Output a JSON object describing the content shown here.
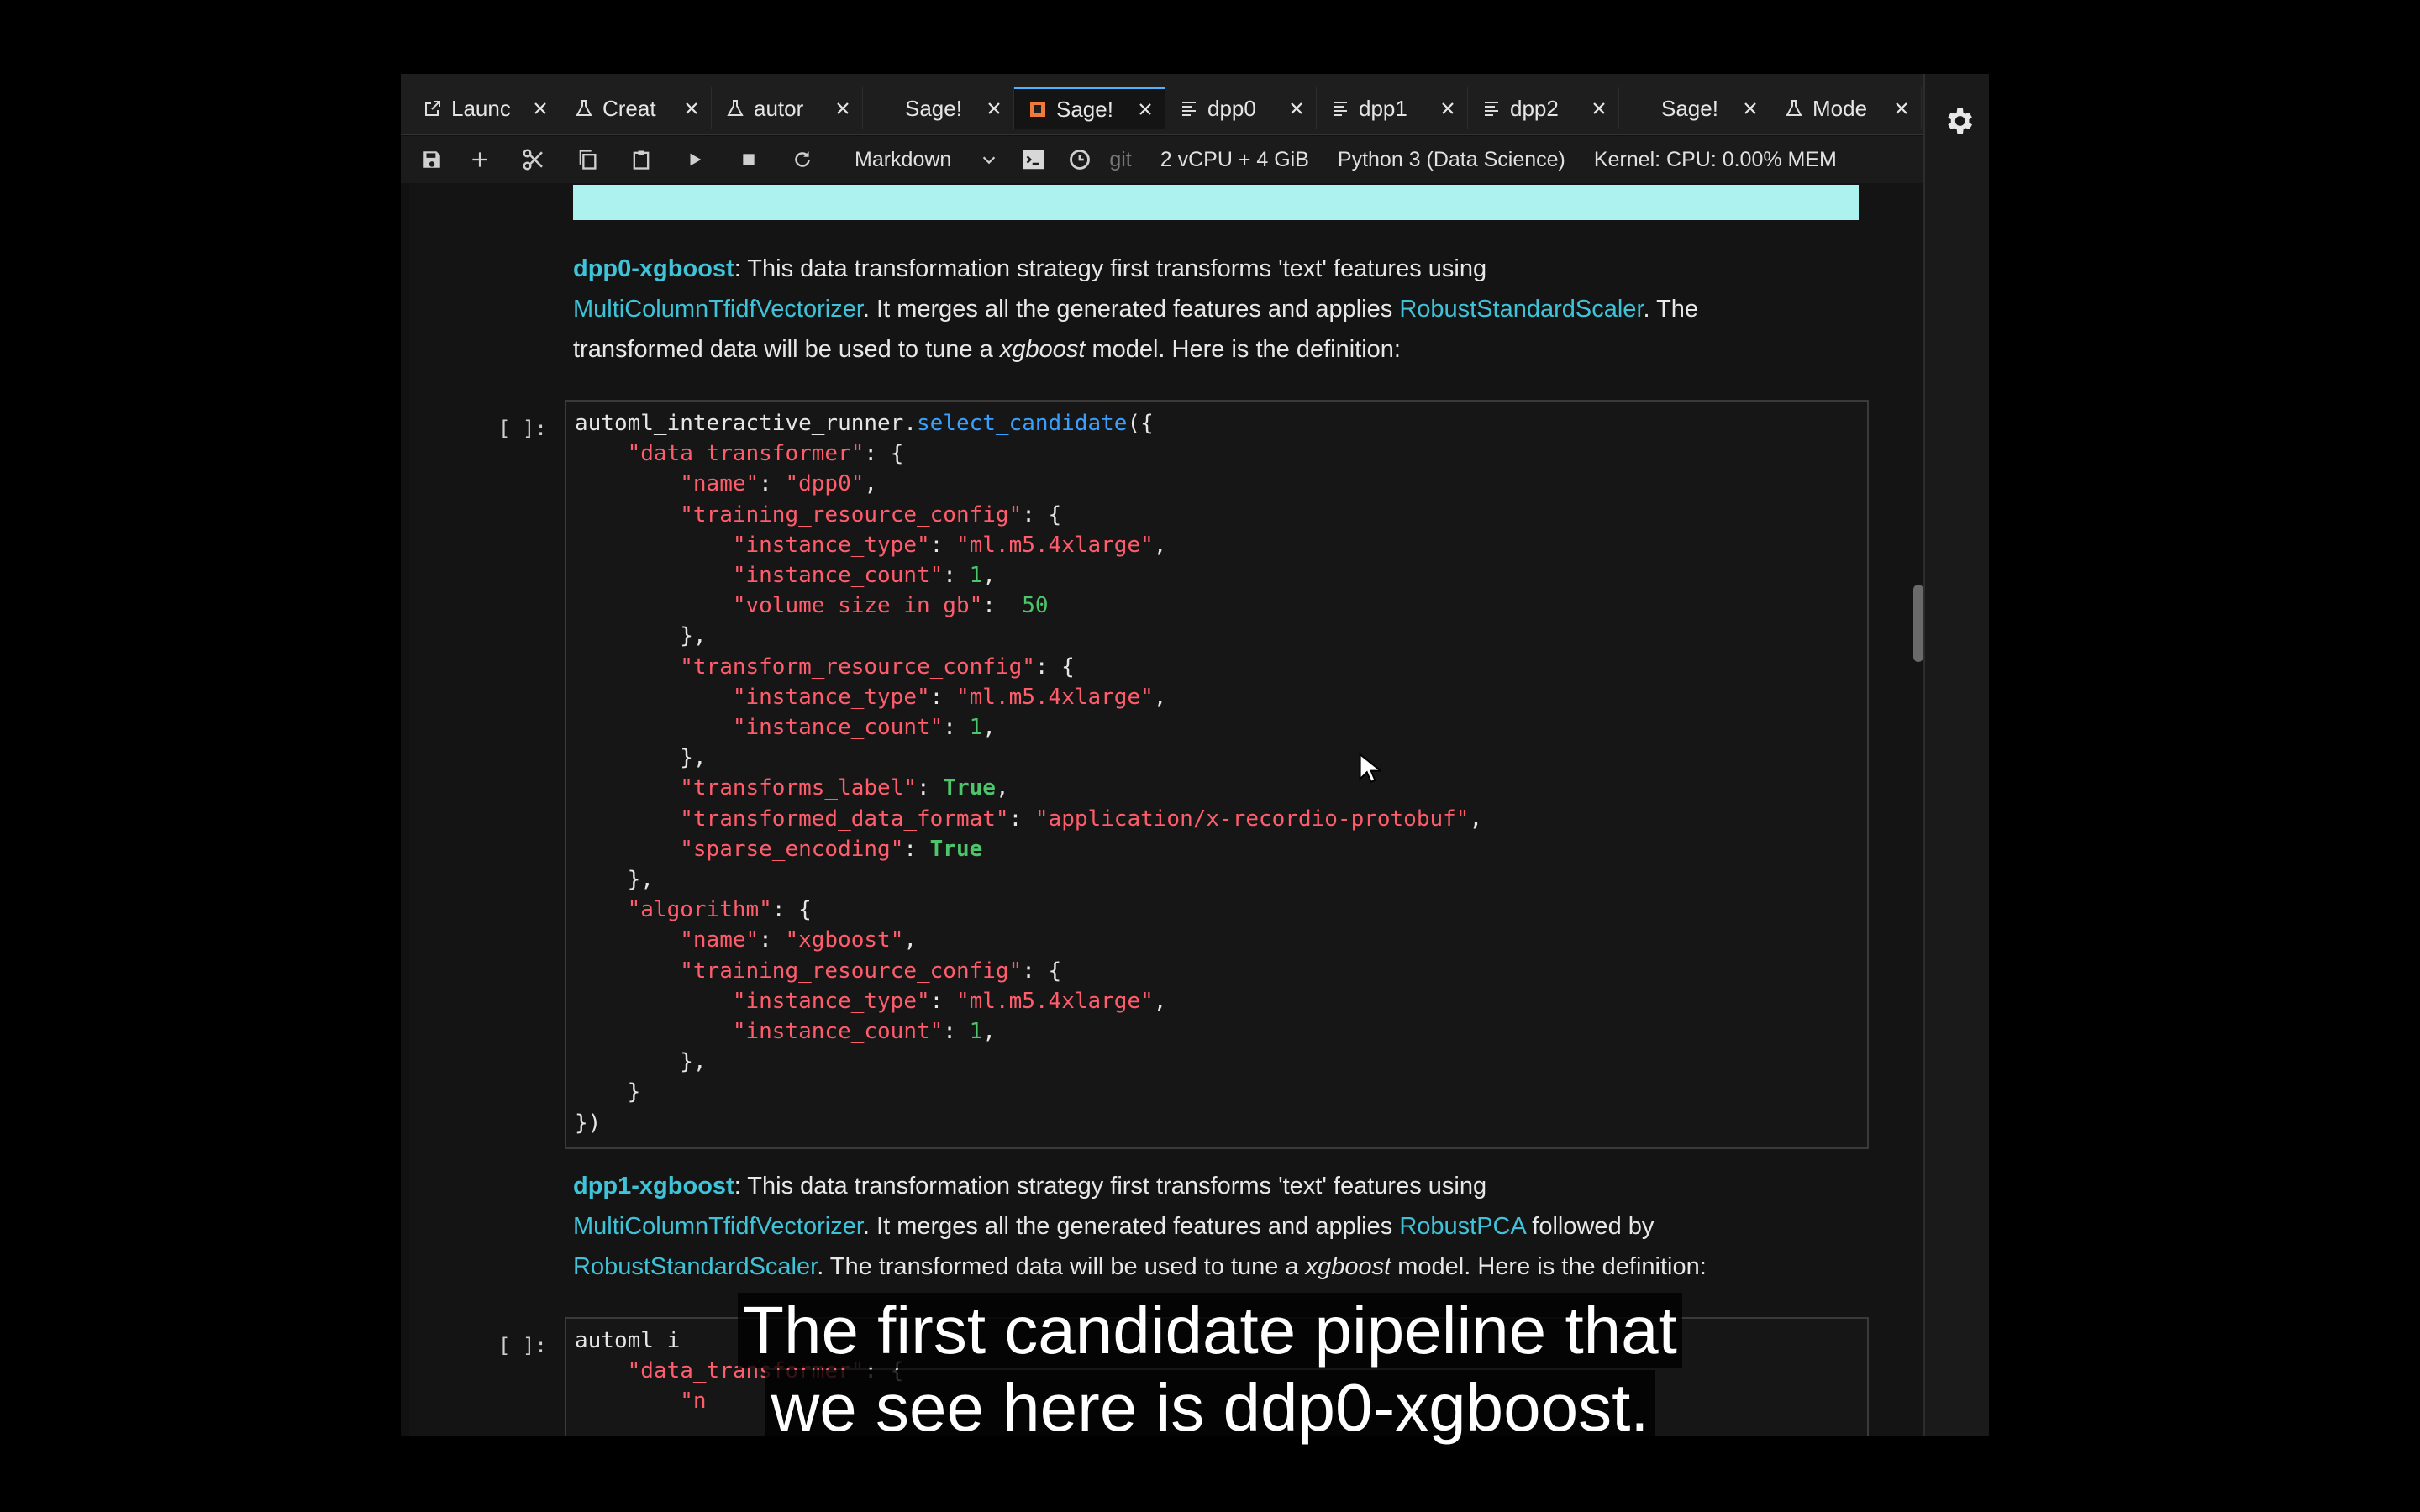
{
  "tabs": [
    {
      "label": "Launc",
      "icon": "external-link-icon"
    },
    {
      "label": "Creat",
      "icon": "flask-icon"
    },
    {
      "label": "autor",
      "icon": "flask-icon"
    },
    {
      "label": "Sage!",
      "icon": "none"
    },
    {
      "label": "Sage!",
      "icon": "notebook-icon",
      "active": true
    },
    {
      "label": "dpp0",
      "icon": "text-file-icon"
    },
    {
      "label": "dpp1",
      "icon": "text-file-icon"
    },
    {
      "label": "dpp2",
      "icon": "text-file-icon"
    },
    {
      "label": "Sage!",
      "icon": "none"
    },
    {
      "label": "Mode",
      "icon": "flask-icon"
    }
  ],
  "toolbar": {
    "cell_type": "Markdown",
    "git": "git",
    "instance": "2 vCPU + 4 GiB",
    "kernel_name": "Python 3 (Data Science)",
    "kernel_status": "Kernel: CPU: 0.00% MEM"
  },
  "md1": {
    "name": "dpp0-xgboost",
    "p1": ": This data transformation strategy first transforms 'text' features using",
    "link1": "MultiColumnTfidfVectorizer",
    "p2": ". It merges all the generated features and applies ",
    "link2": "RobustStandardScaler",
    "p3": ". The",
    "p4": "transformed data will be used to tune a ",
    "model": "xgboost",
    "p5": " model. Here is the definition:"
  },
  "cell1": {
    "prompt": "[ ]:",
    "code": [
      [
        {
          "t": "automl_interactive_runner."
        },
        {
          "t": "select_candidate",
          "c": "fn"
        },
        {
          "t": "({"
        }
      ],
      [
        {
          "t": "    "
        },
        {
          "t": "\"data_transformer\"",
          "c": "s"
        },
        {
          "t": ": {"
        }
      ],
      [
        {
          "t": "        "
        },
        {
          "t": "\"name\"",
          "c": "s"
        },
        {
          "t": ": "
        },
        {
          "t": "\"dpp0\"",
          "c": "s"
        },
        {
          "t": ","
        }
      ],
      [
        {
          "t": "        "
        },
        {
          "t": "\"training_resource_config\"",
          "c": "s"
        },
        {
          "t": ": {"
        }
      ],
      [
        {
          "t": "            "
        },
        {
          "t": "\"instance_type\"",
          "c": "s"
        },
        {
          "t": ": "
        },
        {
          "t": "\"ml.m5.4xlarge\"",
          "c": "s"
        },
        {
          "t": ","
        }
      ],
      [
        {
          "t": "            "
        },
        {
          "t": "\"instance_count\"",
          "c": "s"
        },
        {
          "t": ": "
        },
        {
          "t": "1",
          "c": "n"
        },
        {
          "t": ","
        }
      ],
      [
        {
          "t": "            "
        },
        {
          "t": "\"volume_size_in_gb\"",
          "c": "s"
        },
        {
          "t": ":  "
        },
        {
          "t": "50",
          "c": "n"
        }
      ],
      [
        {
          "t": "        },"
        }
      ],
      [
        {
          "t": "        "
        },
        {
          "t": "\"transform_resource_config\"",
          "c": "s"
        },
        {
          "t": ": {"
        }
      ],
      [
        {
          "t": "            "
        },
        {
          "t": "\"instance_type\"",
          "c": "s"
        },
        {
          "t": ": "
        },
        {
          "t": "\"ml.m5.4xlarge\"",
          "c": "s"
        },
        {
          "t": ","
        }
      ],
      [
        {
          "t": "            "
        },
        {
          "t": "\"instance_count\"",
          "c": "s"
        },
        {
          "t": ": "
        },
        {
          "t": "1",
          "c": "n"
        },
        {
          "t": ","
        }
      ],
      [
        {
          "t": "        },"
        }
      ],
      [
        {
          "t": "        "
        },
        {
          "t": "\"transforms_label\"",
          "c": "s"
        },
        {
          "t": ": "
        },
        {
          "t": "True",
          "c": "kw"
        },
        {
          "t": ","
        }
      ],
      [
        {
          "t": "        "
        },
        {
          "t": "\"transformed_data_format\"",
          "c": "s"
        },
        {
          "t": ": "
        },
        {
          "t": "\"application/x-recordio-protobuf\"",
          "c": "s"
        },
        {
          "t": ","
        }
      ],
      [
        {
          "t": "        "
        },
        {
          "t": "\"sparse_encoding\"",
          "c": "s"
        },
        {
          "t": ": "
        },
        {
          "t": "True",
          "c": "kw"
        }
      ],
      [
        {
          "t": "    },"
        }
      ],
      [
        {
          "t": "    "
        },
        {
          "t": "\"algorithm\"",
          "c": "s"
        },
        {
          "t": ": {"
        }
      ],
      [
        {
          "t": "        "
        },
        {
          "t": "\"name\"",
          "c": "s"
        },
        {
          "t": ": "
        },
        {
          "t": "\"xgboost\"",
          "c": "s"
        },
        {
          "t": ","
        }
      ],
      [
        {
          "t": "        "
        },
        {
          "t": "\"training_resource_config\"",
          "c": "s"
        },
        {
          "t": ": {"
        }
      ],
      [
        {
          "t": "            "
        },
        {
          "t": "\"instance_type\"",
          "c": "s"
        },
        {
          "t": ": "
        },
        {
          "t": "\"ml.m5.4xlarge\"",
          "c": "s"
        },
        {
          "t": ","
        }
      ],
      [
        {
          "t": "            "
        },
        {
          "t": "\"instance_count\"",
          "c": "s"
        },
        {
          "t": ": "
        },
        {
          "t": "1",
          "c": "n"
        },
        {
          "t": ","
        }
      ],
      [
        {
          "t": "        },"
        }
      ],
      [
        {
          "t": "    }"
        }
      ],
      [
        {
          "t": "})"
        }
      ]
    ]
  },
  "md2": {
    "name": "dpp1-xgboost",
    "p1": ": This data transformation strategy first transforms 'text' features using",
    "link1": "MultiColumnTfidfVectorizer",
    "p2": ". It merges all the generated features and applies ",
    "link2": "RobustPCA",
    "p3": " followed by",
    "link3": "RobustStandardScaler",
    "p4": ". The transformed data will be used to tune a ",
    "model": "xgboost",
    "p5": " model. Here is the definition:"
  },
  "cell2": {
    "prompt": "[ ]:",
    "code": [
      [
        {
          "t": "automl_i"
        }
      ],
      [
        {
          "t": "    "
        },
        {
          "t": "\"data_transformer\"",
          "c": "s"
        },
        {
          "t": ": {"
        }
      ],
      [
        {
          "t": "        "
        },
        {
          "t": "\"n",
          "c": "s"
        }
      ]
    ]
  },
  "subtitle": {
    "line1": "The first candidate pipeline that",
    "line2": "we see here is ddp0-xgboost."
  },
  "colors": {
    "accent_cyan": "#3fc3d8",
    "string": "#ff5c6c",
    "number": "#4cc56b",
    "function": "#3aa0ff"
  }
}
